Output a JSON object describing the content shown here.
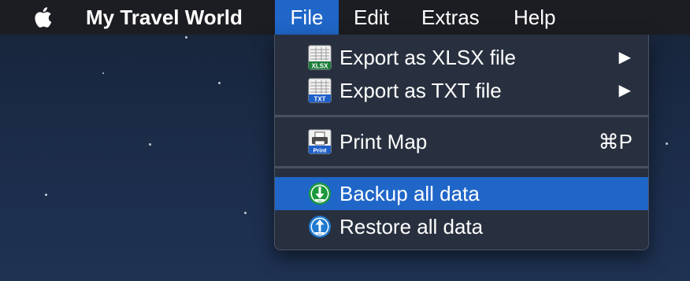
{
  "menubar": {
    "app_name": "My Travel World",
    "menus": [
      "File",
      "Edit",
      "Extras",
      "Help"
    ],
    "active_menu": "File"
  },
  "file_menu": {
    "items": [
      {
        "label": "Export as XLSX file",
        "icon": "xlsx-file-icon",
        "icon_text": "XLSX",
        "submenu": "▶"
      },
      {
        "label": "Export as TXT file",
        "icon": "txt-file-icon",
        "icon_text": "TXT",
        "submenu": "▶"
      },
      {
        "label": "Print Map",
        "icon": "printer-icon",
        "icon_text": "Print",
        "shortcut": "⌘P"
      },
      {
        "label": "Backup all data",
        "icon": "download-icon",
        "highlighted": true
      },
      {
        "label": "Restore all data",
        "icon": "upload-icon"
      }
    ]
  },
  "colors": {
    "highlight": "#1f66c8",
    "menu_bg": "#28303f",
    "menubar_bg": "#1c1d22",
    "xlsx_green": "#1e7e3c",
    "txt_blue": "#1f5fc8",
    "backup_green": "#1a9a3c",
    "restore_blue": "#1f7ad0"
  }
}
